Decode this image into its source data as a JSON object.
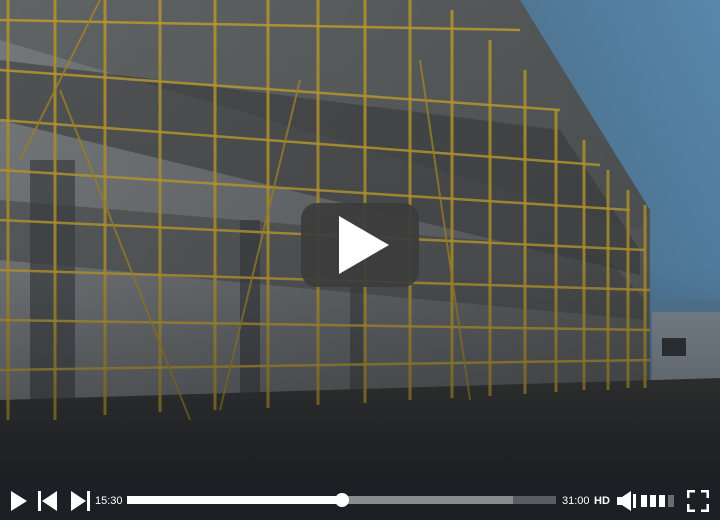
{
  "player": {
    "state": "paused",
    "current_time": "15:30",
    "duration": "31:00",
    "quality_label": "HD",
    "progress_fraction": 0.5,
    "buffered_fraction": 0.9,
    "volume_level": 0.75,
    "controls": [
      "play",
      "skip-back",
      "skip-forward",
      "progress",
      "quality",
      "volume",
      "fullscreen"
    ]
  },
  "colors": {
    "control_bar": "#1c1f23",
    "progress_played": "#ffffff",
    "progress_buffered": "#8a8c90",
    "progress_track": "#5a5d62",
    "overlay_button": "#3c3c3c"
  },
  "icons": {
    "play": "play-icon",
    "skip_back": "skip-back-icon",
    "skip_forward": "skip-forward-icon",
    "volume": "volume-icon",
    "fullscreen": "fullscreen-icon",
    "big_play": "play-icon"
  }
}
